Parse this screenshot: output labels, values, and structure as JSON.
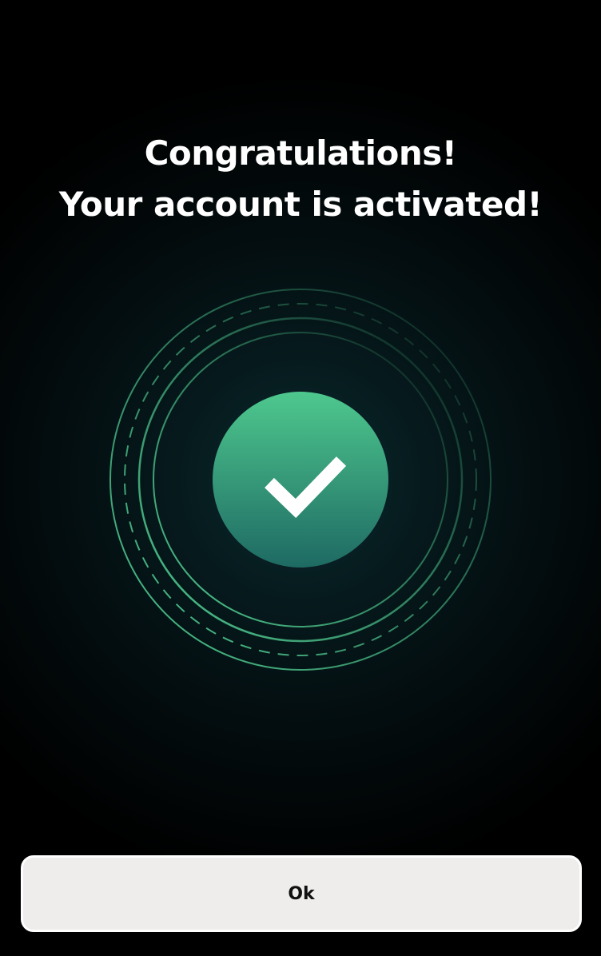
{
  "dialog": {
    "title_line1": "Congratulations!",
    "title_line2": "Your account is activated!",
    "ok_label": "Ok"
  },
  "icons": {
    "status": "check-icon"
  },
  "colors": {
    "background": "#000000",
    "accent_top": "#4ec88e",
    "accent_bottom": "#1e6a63",
    "ring": "#4ec88e",
    "button_bg": "#eeedeb",
    "button_text": "#111111",
    "title_text": "#ffffff"
  }
}
